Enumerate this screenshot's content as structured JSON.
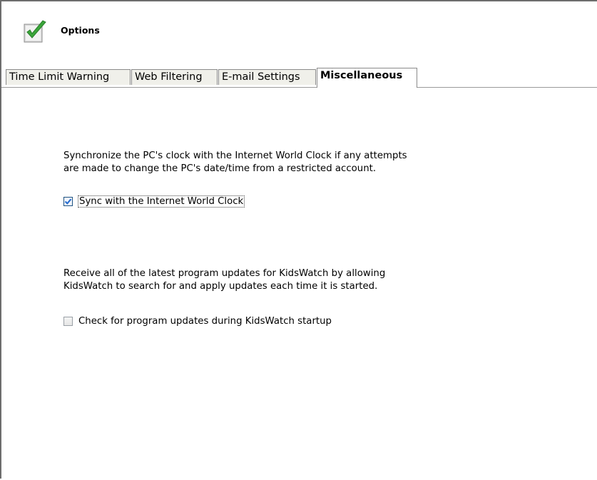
{
  "header": {
    "title": "Options",
    "icon": "green-checkmark-icon"
  },
  "tabs": [
    {
      "label": "Time Limit Warning",
      "active": false
    },
    {
      "label": "Web Filtering",
      "active": false
    },
    {
      "label": "E-mail Settings",
      "active": false
    },
    {
      "label": "Miscellaneous",
      "active": true
    }
  ],
  "clock_section": {
    "description_line1": "Synchronize the PC's clock with the Internet World Clock if any attempts",
    "description_line2": "are made to change the PC's date/time from a restricted account.",
    "checkbox_label": "Sync with the Internet World Clock",
    "checked": true
  },
  "updates_section": {
    "description_line1": "Receive all of the latest program updates for KidsWatch by allowing",
    "description_line2": "KidsWatch to search for and apply updates each time it is started.",
    "checkbox_label": "Check for program updates during KidsWatch startup",
    "checked": false
  },
  "colors": {
    "accent_check": "#3aa63a",
    "checkbox_checked": "#2a6fd0"
  }
}
